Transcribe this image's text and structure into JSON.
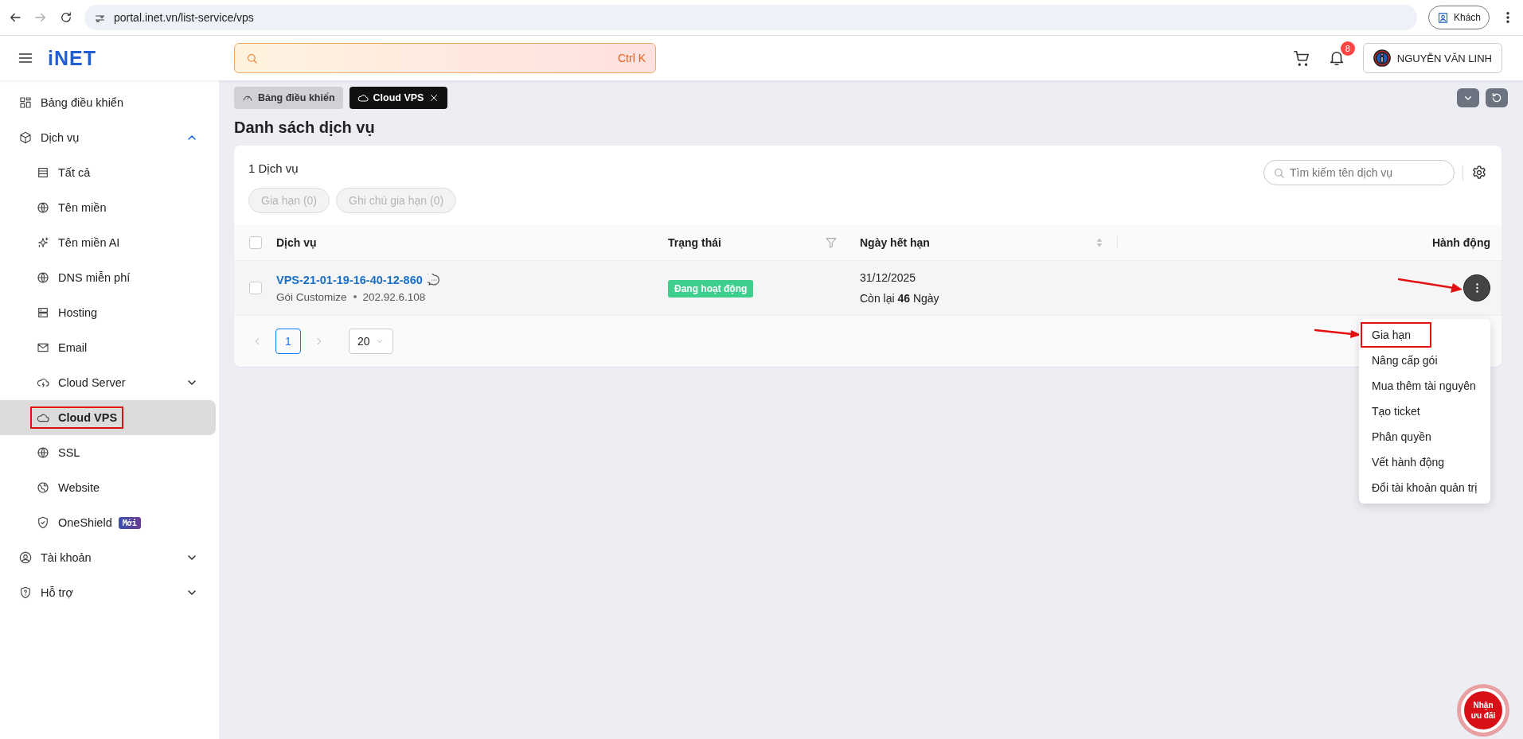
{
  "browser": {
    "url": "portal.inet.vn/list-service/vps",
    "profile": "Khách"
  },
  "header": {
    "logo": "iNET",
    "search_shortcut": "Ctrl K",
    "notification_count": "8",
    "user_name": "NGUYỄN VĂN LINH"
  },
  "sidebar": {
    "items": [
      {
        "label": "Bảng điều khiển",
        "selected": false
      },
      {
        "label": "Dịch vụ",
        "selected": false,
        "expanded": true,
        "children": [
          {
            "label": "Tất cả",
            "selected": false,
            "highlighted": false
          },
          {
            "label": "Tên miền",
            "selected": false,
            "highlighted": false
          },
          {
            "label": "Tên miền AI",
            "selected": false,
            "highlighted": false
          },
          {
            "label": "DNS miễn phí",
            "selected": false,
            "highlighted": false
          },
          {
            "label": "Hosting",
            "selected": false,
            "highlighted": false
          },
          {
            "label": "Email",
            "selected": false,
            "highlighted": false
          },
          {
            "label": "Cloud Server",
            "selected": false,
            "highlighted": false,
            "expanded": false
          },
          {
            "label": "Cloud VPS",
            "selected": true,
            "highlighted": true
          },
          {
            "label": "SSL",
            "selected": false,
            "highlighted": false
          },
          {
            "label": "Website",
            "selected": false,
            "highlighted": false
          },
          {
            "label": "OneShield",
            "selected": false,
            "highlighted": false,
            "badge": "Mới"
          }
        ]
      },
      {
        "label": "Tài khoản",
        "selected": false,
        "expanded": false
      },
      {
        "label": "Hỗ trợ",
        "selected": false,
        "expanded": false
      }
    ]
  },
  "tabs": [
    {
      "label": "Bảng điều khiển",
      "selected": false,
      "closable": false
    },
    {
      "label": "Cloud VPS",
      "selected": true,
      "closable": true
    }
  ],
  "page_title": "Danh sách dịch vụ",
  "service_count": "1 Dịch vụ",
  "search": {
    "placeholder": "Tìm kiếm tên dịch vụ"
  },
  "bulk_buttons": [
    {
      "label": "Gia hạn (0)",
      "disabled": true
    },
    {
      "label": "Ghi chú gia hạn (0)",
      "disabled": true
    }
  ],
  "table": {
    "select_all_checked": false,
    "columns": [
      {
        "label": "Dịch vụ",
        "kind": "plain"
      },
      {
        "label": "Trạng thái",
        "kind": "filter"
      },
      {
        "label": "Ngày hết hạn",
        "kind": "sort"
      },
      {
        "label": "Hành động",
        "kind": "action"
      }
    ],
    "rows": [
      {
        "checked": false,
        "service": "VPS-21-01-19-16-40-12-860",
        "plan": "Gói Customize",
        "ip": "202.92.6.108",
        "status": "Đang hoạt động",
        "expiry": "31/12/2025",
        "remaining": "Còn lại **46** Ngày",
        "action_highlighted": true
      }
    ]
  },
  "pagination": {
    "pages": [
      {
        "label": "1",
        "selected": true
      }
    ],
    "page_size": "20"
  },
  "action_menu": {
    "items": [
      {
        "label": "Gia hạn",
        "highlighted": true
      },
      {
        "label": "Nâng cấp gói",
        "highlighted": false
      },
      {
        "label": "Mua thêm tài nguyên",
        "highlighted": false
      },
      {
        "label": "Tạo ticket",
        "highlighted": false
      },
      {
        "label": "Phân quyền",
        "highlighted": false
      },
      {
        "label": "Vết hành động",
        "highlighted": false
      },
      {
        "label": "Đổi tài khoản quản trị",
        "highlighted": false
      }
    ]
  },
  "promo_button": "Nhận ưu đãi"
}
